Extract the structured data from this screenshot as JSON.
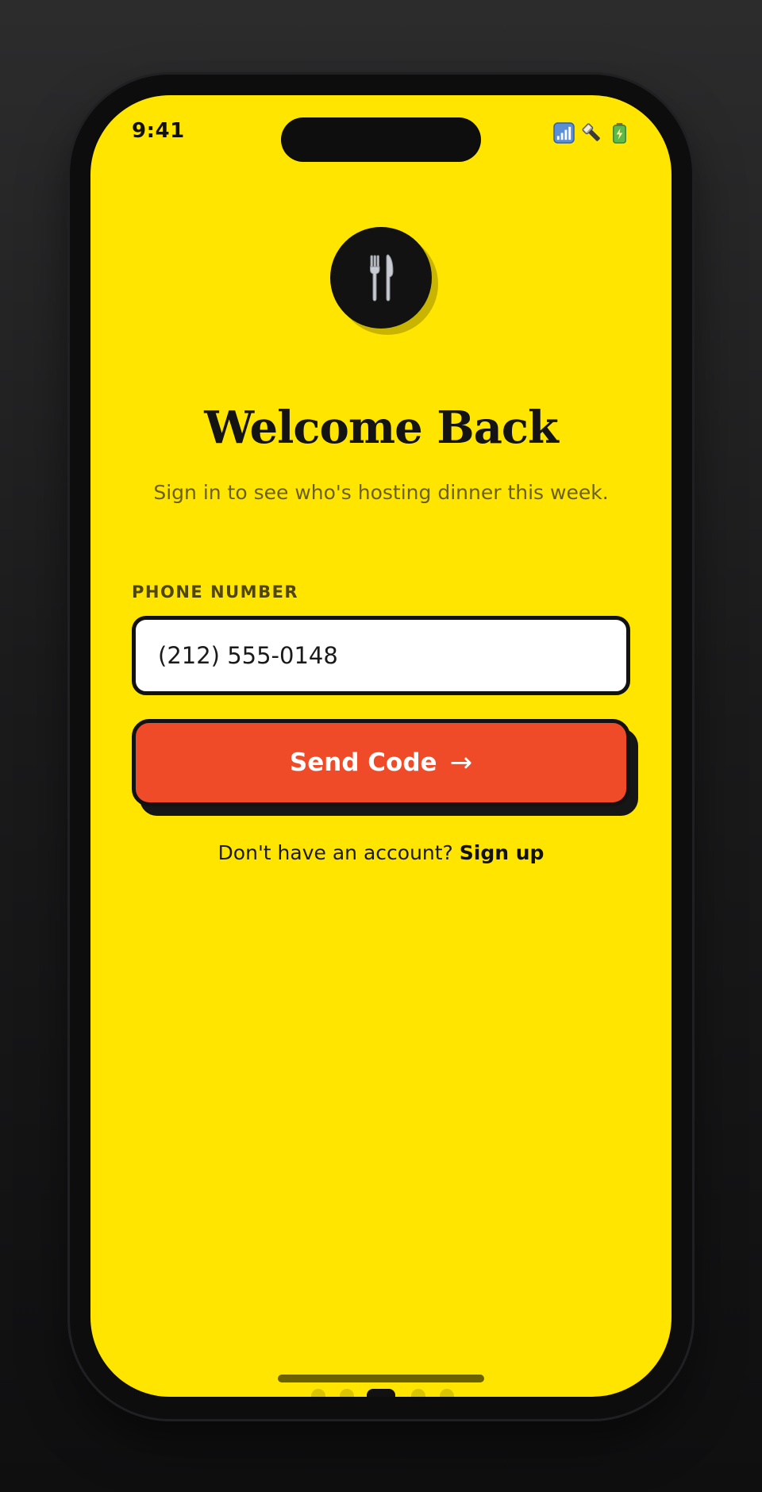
{
  "status_bar": {
    "time": "9:41",
    "icons": [
      "signal-icon",
      "flashlight-icon",
      "battery-icon"
    ]
  },
  "app": {
    "logo_icon": "fork-knife-icon",
    "title": "Welcome Back",
    "subtitle": "Sign in to see who's hosting dinner this week."
  },
  "form": {
    "phone_label": "PHONE NUMBER",
    "phone_value": "(212) 555-0148",
    "submit_label": "Send Code",
    "submit_arrow": "→"
  },
  "footer": {
    "prompt": "Don't have an account?",
    "signup_label": "Sign up"
  },
  "pager": {
    "count": 5,
    "active_index": 2
  },
  "colors": {
    "background": "#FFE500",
    "accent": "#F04B29",
    "ink": "#121212"
  }
}
